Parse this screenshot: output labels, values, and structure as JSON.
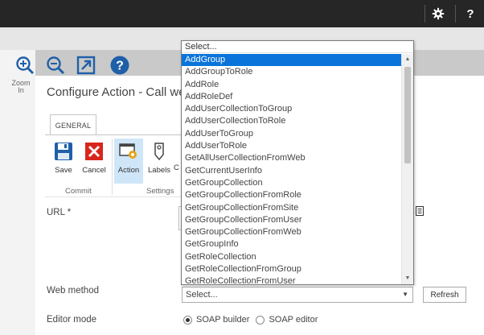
{
  "suite_bar": {
    "settings_icon": "gear-icon",
    "help_label": "?"
  },
  "page_ribbon": {
    "zoom_label": "Zoom In",
    "icons": [
      "zoom-in-icon",
      "zoom-out-icon",
      "open-in-new-icon",
      "help-icon"
    ]
  },
  "dialog": {
    "title": "Configure Action - Call web",
    "tab": "GENERAL",
    "buttons": {
      "save": "Save",
      "cancel": "Cancel",
      "action": "Action",
      "labels": "Labels",
      "partial": "C"
    },
    "groups": {
      "commit": "Commit",
      "settings": "Settings"
    }
  },
  "form": {
    "url_label": "URL *",
    "web_method_label": "Web method",
    "web_method_value": "Select...",
    "refresh_label": "Refresh",
    "editor_mode_label": "Editor mode",
    "editor_modes": [
      "SOAP builder",
      "SOAP editor"
    ],
    "editor_mode_selected": "SOAP builder"
  },
  "dropdown": {
    "header": "Select...",
    "selected": "AddGroup",
    "options": [
      "AddGroup",
      "AddGroupToRole",
      "AddRole",
      "AddRoleDef",
      "AddUserCollectionToGroup",
      "AddUserCollectionToRole",
      "AddUserToGroup",
      "AddUserToRole",
      "GetAllUserCollectionFromWeb",
      "GetCurrentUserInfo",
      "GetGroupCollection",
      "GetGroupCollectionFromRole",
      "GetGroupCollectionFromSite",
      "GetGroupCollectionFromUser",
      "GetGroupCollectionFromWeb",
      "GetGroupInfo",
      "GetRoleCollection",
      "GetRoleCollectionFromGroup",
      "GetRoleCollectionFromUser"
    ]
  },
  "colors": {
    "suite_bar": "#262626",
    "selection": "#0a74da",
    "active_button": "#cfe6f9",
    "save_blue": "#1f5fa8",
    "cancel_red": "#d9261c"
  }
}
